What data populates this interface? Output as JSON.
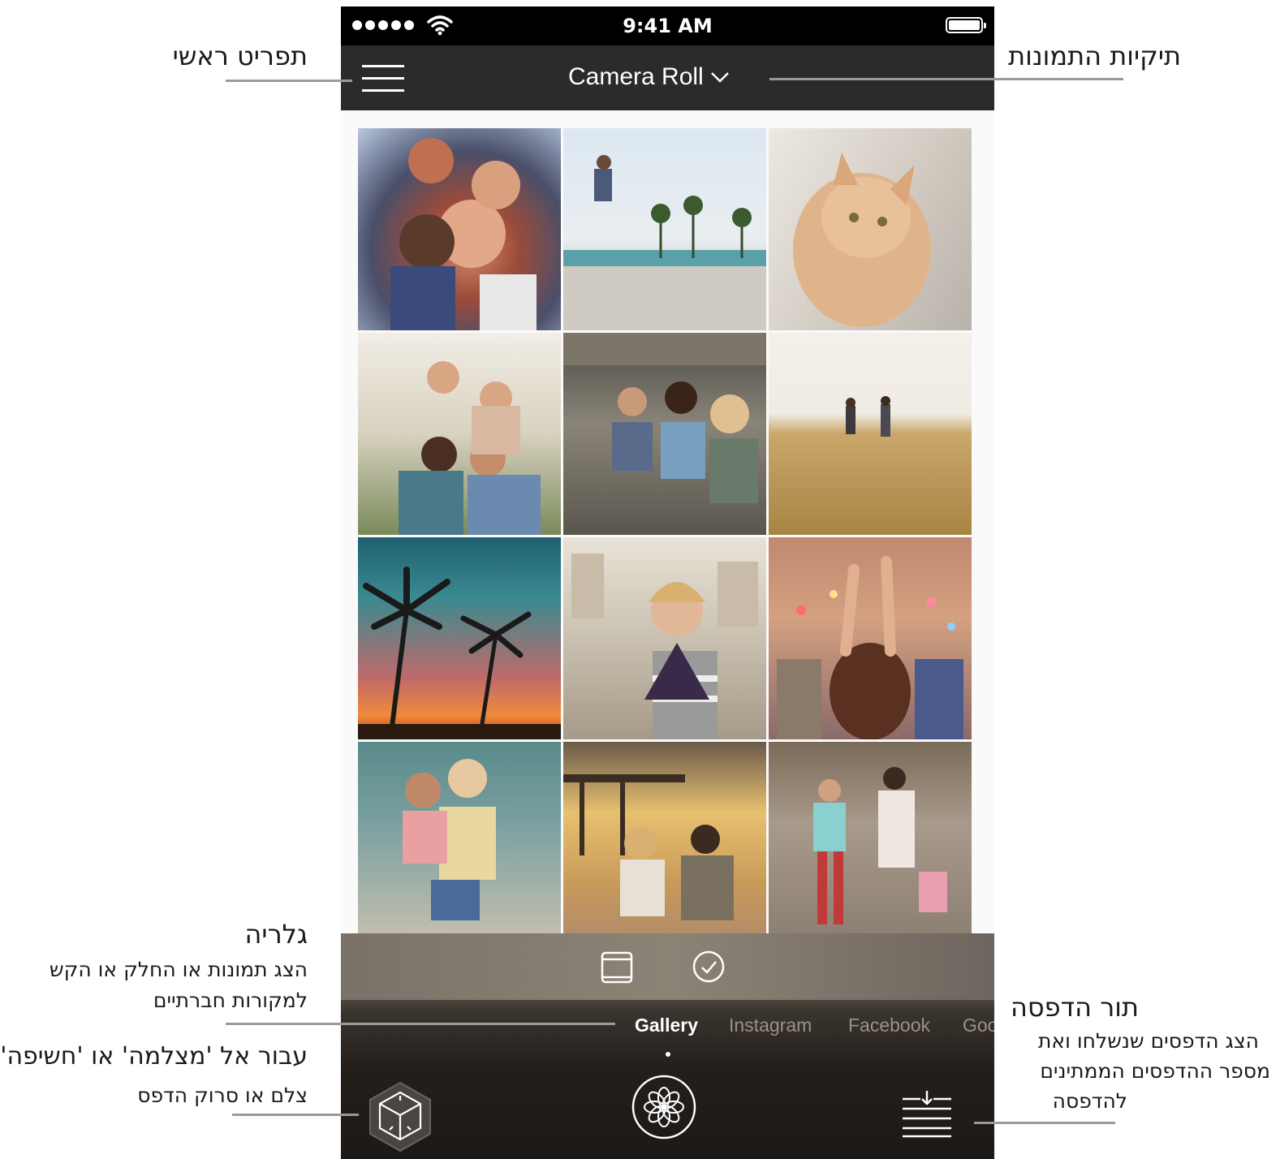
{
  "status_bar": {
    "time": "9:41 AM"
  },
  "nav_bar": {
    "title": "Camera Roll"
  },
  "photo_grid": {
    "photos": [
      "group-selfie",
      "skateboarder-jump",
      "orange-kitten",
      "festival-friends",
      "car-friends",
      "wheat-field-couple",
      "palm-sunset",
      "kiss-selfie-girl",
      "concert-crowd",
      "piggyback-friends",
      "pier-couple",
      "shopping-friends"
    ]
  },
  "source_tabs": [
    "Gallery",
    "Instagram",
    "Facebook",
    "Goo"
  ],
  "annotations": {
    "main_menu": "תפריט ראשי",
    "photo_folders": "תיקיות התמונות",
    "gallery_title": "גלריה",
    "gallery_desc_1": "הצג תמונות או החלק או הקש",
    "gallery_desc_2": "למקורות חברתיים",
    "camera_title": "עבור אל 'מצלמה' או 'חשיפה'",
    "camera_desc": "צלם או סרוק הדפס",
    "queue_title": "תור הדפסה",
    "queue_desc_1": "הצג הדפסים שנשלחו ואת",
    "queue_desc_2": "מספר ההדפסים הממתינים",
    "queue_desc_3": "להדפסה"
  }
}
